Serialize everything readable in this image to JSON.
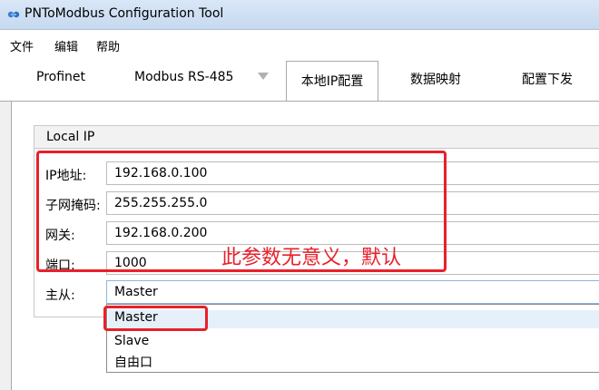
{
  "window": {
    "title": "PNToModbus Configuration Tool",
    "icon": "app-icon"
  },
  "menu": {
    "items": [
      "文件",
      "编辑",
      "帮助"
    ]
  },
  "tabs": [
    {
      "label": "Profinet",
      "active": false
    },
    {
      "label": "Modbus RS-485",
      "active": false
    },
    {
      "label": "本地IP配置",
      "active": true
    },
    {
      "label": "数据映射",
      "active": false
    },
    {
      "label": "配置下发",
      "active": false
    }
  ],
  "group": {
    "title": "Local IP"
  },
  "fields": {
    "ip": {
      "label": "IP地址:",
      "value": "192.168.0.100"
    },
    "mask": {
      "label": "子网掩码:",
      "value": "255.255.255.0"
    },
    "gateway": {
      "label": "网关:",
      "value": "192.168.0.200"
    },
    "port": {
      "label": "端口:",
      "value": "1000"
    },
    "role": {
      "label": "主从:",
      "value": "Master"
    }
  },
  "dropdown": {
    "options": [
      "Master",
      "Slave",
      "自由口"
    ],
    "highlighted": "Master"
  },
  "annotation": {
    "text": "此参数无意义，默认",
    "color": "#e8202a"
  }
}
